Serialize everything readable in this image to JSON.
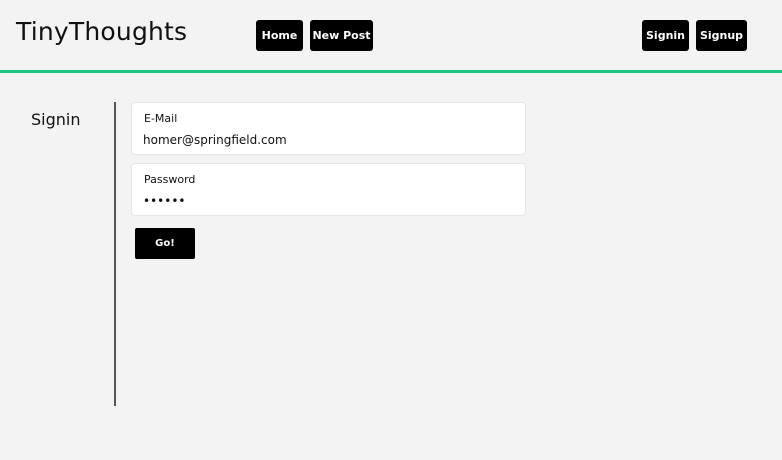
{
  "header": {
    "brand": "TinyThoughts",
    "nav_left": [
      {
        "label": "Home"
      },
      {
        "label": "New Post"
      }
    ],
    "nav_right": [
      {
        "label": "Signin"
      },
      {
        "label": "Signup"
      }
    ],
    "accent_color": "#23c483"
  },
  "page": {
    "title": "Signin"
  },
  "form": {
    "email": {
      "label": "E-Mail",
      "value": "homer@springfield.com"
    },
    "password": {
      "label": "Password",
      "value": "••••••"
    },
    "submit_label": "Go!"
  }
}
